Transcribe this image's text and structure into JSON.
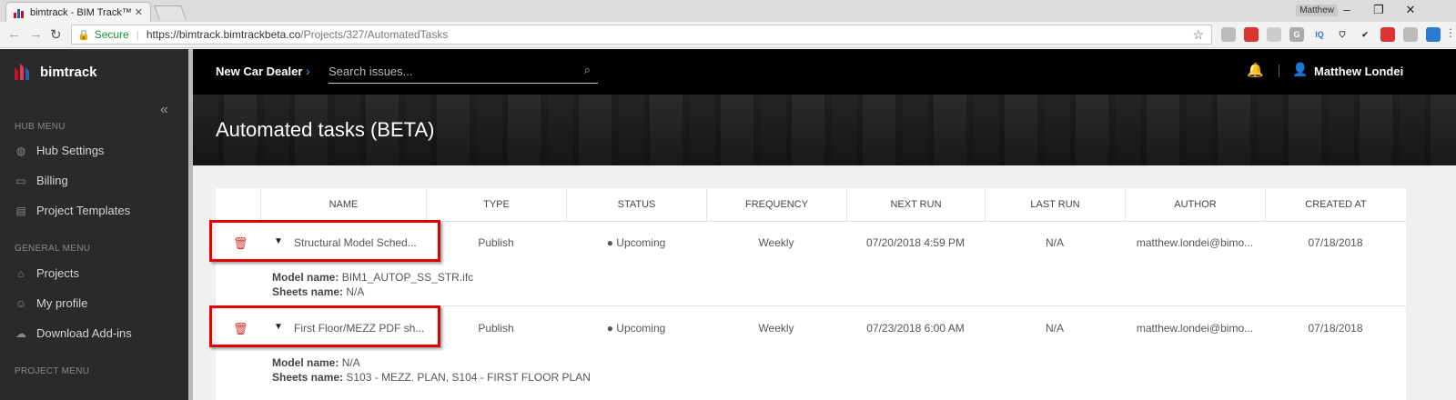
{
  "browser": {
    "tab_title": "bimtrack - BIM Track™",
    "window_user": "Matthew",
    "url_secure_label": "Secure",
    "url_host": "https://bimtrack.bimtrackbeta.co",
    "url_path": "/Projects/327/AutomatedTasks"
  },
  "sidebar": {
    "brand": "bimtrack",
    "sections": [
      {
        "title": "HUB MENU",
        "items": [
          {
            "label": "Hub Settings",
            "icon": "globe-icon"
          },
          {
            "label": "Billing",
            "icon": "card-icon"
          },
          {
            "label": "Project Templates",
            "icon": "document-icon"
          }
        ]
      },
      {
        "title": "GENERAL MENU",
        "items": [
          {
            "label": "Projects",
            "icon": "home-icon"
          },
          {
            "label": "My profile",
            "icon": "user-icon"
          },
          {
            "label": "Download Add-ins",
            "icon": "cloud-download-icon"
          }
        ]
      },
      {
        "title": "PROJECT MENU",
        "items": []
      }
    ]
  },
  "topbar": {
    "project": "New Car Dealer",
    "search_placeholder": "Search issues...",
    "user_name": "Matthew Londei"
  },
  "page": {
    "title": "Automated tasks (BETA)"
  },
  "table": {
    "columns": [
      "NAME",
      "TYPE",
      "STATUS",
      "FREQUENCY",
      "NEXT RUN",
      "LAST RUN",
      "AUTHOR",
      "CREATED AT"
    ],
    "rows": [
      {
        "name": "Structural Model Sched...",
        "type": "Publish",
        "status": "Upcoming",
        "frequency": "Weekly",
        "next_run": "07/20/2018 4:59 PM",
        "last_run": "N/A",
        "author": "matthew.londei@bimo...",
        "created_at": "07/18/2018",
        "model_label": "Model name:",
        "model_value": "BIM1_AUTOP_SS_STR.ifc",
        "sheets_label": "Sheets name:",
        "sheets_value": "N/A"
      },
      {
        "name": "First Floor/MEZZ PDF sh...",
        "type": "Publish",
        "status": "Upcoming",
        "frequency": "Weekly",
        "next_run": "07/23/2018 6:00 AM",
        "last_run": "N/A",
        "author": "matthew.londei@bimo...",
        "created_at": "07/18/2018",
        "model_label": "Model name:",
        "model_value": "N/A",
        "sheets_label": "Sheets name:",
        "sheets_value": "S103 - MEZZ. PLAN, S104 - FIRST FLOOR PLAN"
      }
    ]
  },
  "colors": {
    "accent": "#5b9bd5",
    "delete": "#d32f2f",
    "highlight": "#e00000"
  }
}
